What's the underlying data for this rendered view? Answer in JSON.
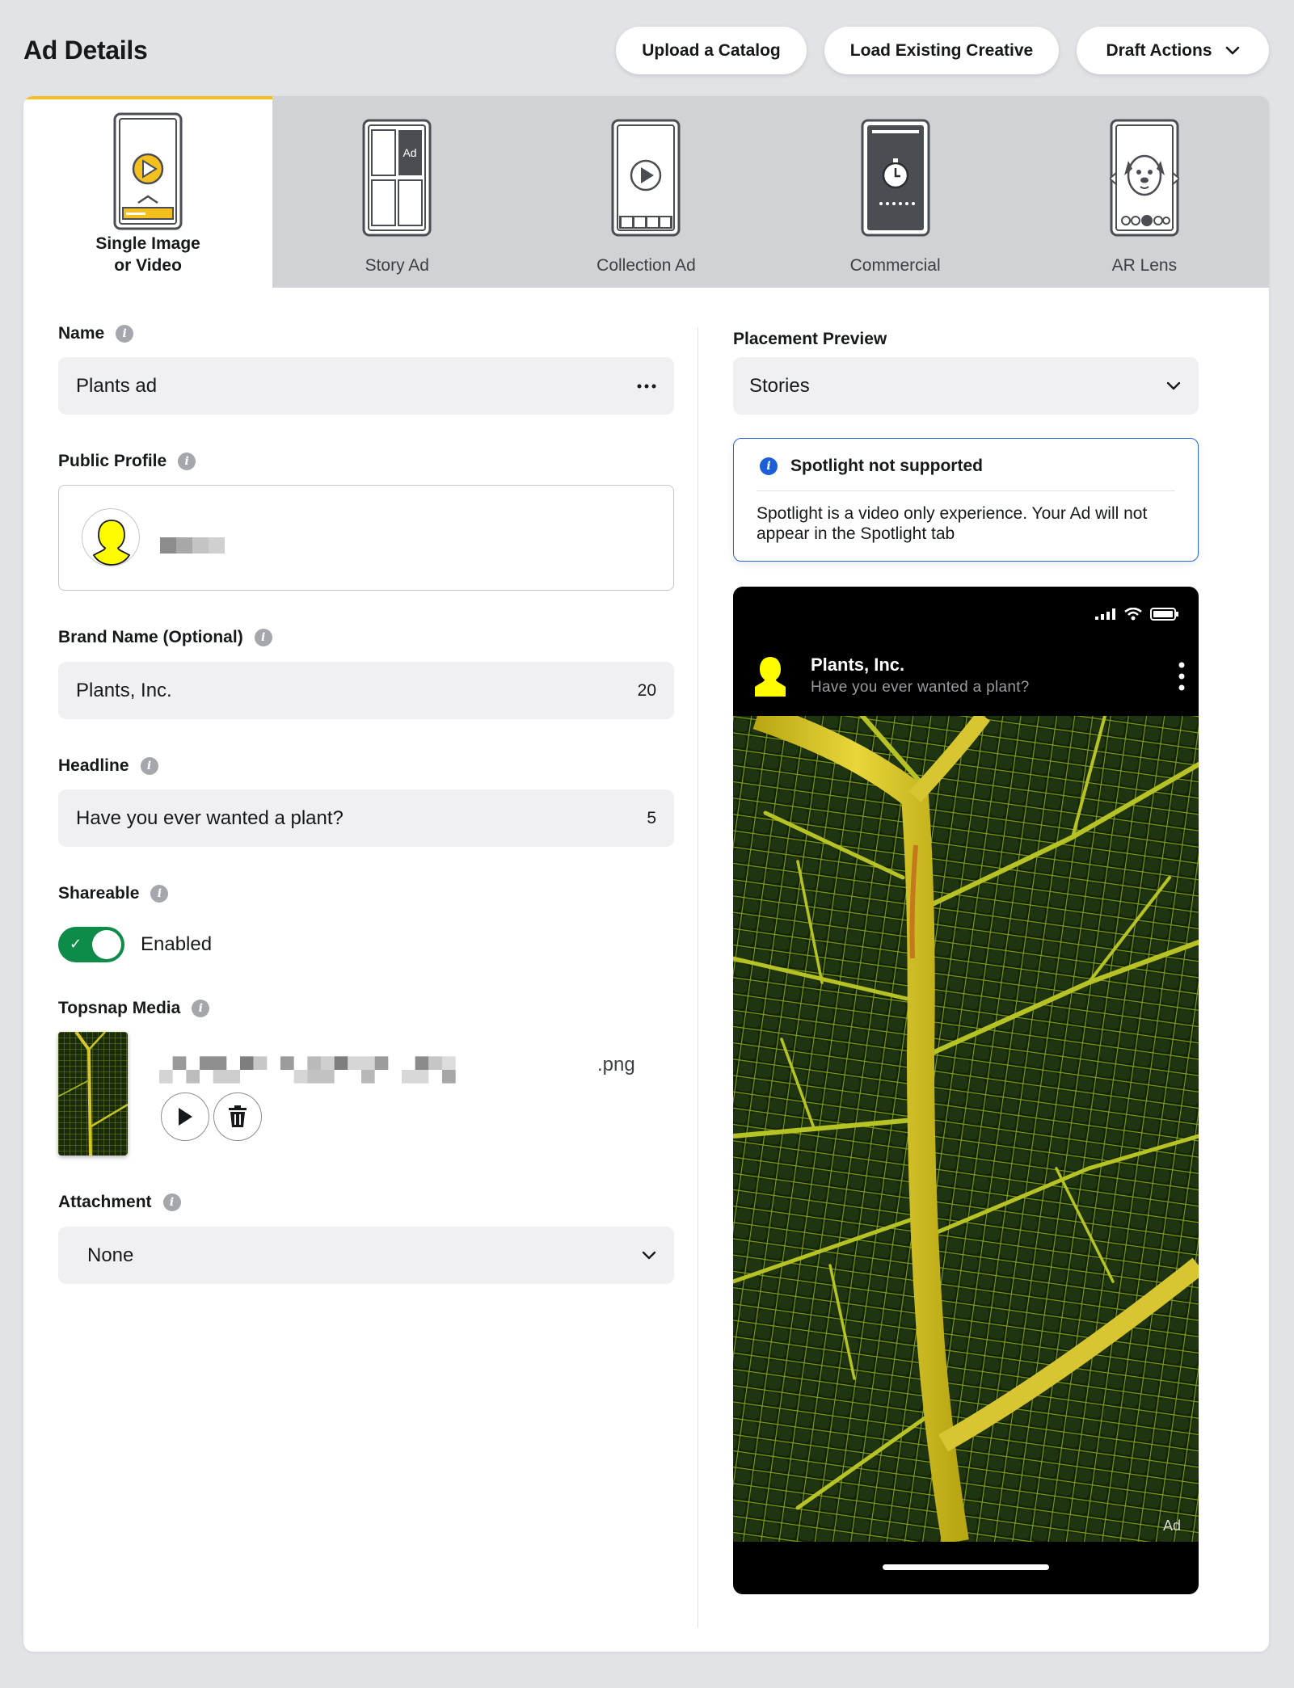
{
  "header": {
    "title": "Ad Details",
    "upload_catalog": "Upload a Catalog",
    "load_creative": "Load Existing Creative",
    "draft_actions": "Draft Actions"
  },
  "tabs": [
    {
      "label": "Single Image or Video",
      "icon": "single-image-video-icon",
      "active": true
    },
    {
      "label": "Story Ad",
      "icon": "story-ad-icon",
      "active": false
    },
    {
      "label": "Collection Ad",
      "icon": "collection-ad-icon",
      "active": false
    },
    {
      "label": "Commercial",
      "icon": "commercial-icon",
      "active": false
    },
    {
      "label": "AR Lens",
      "icon": "ar-lens-icon",
      "active": false
    }
  ],
  "form": {
    "name_label": "Name",
    "name_value": "Plants ad",
    "public_profile_label": "Public Profile",
    "brand_label": "Brand Name (Optional)",
    "brand_value": "Plants, Inc.",
    "brand_count": "20",
    "headline_label": "Headline",
    "headline_value": "Have you ever wanted a plant?",
    "headline_count": "5",
    "shareable_label": "Shareable",
    "shareable_state": "Enabled",
    "topsnap_label": "Topsnap Media",
    "file_ext": ".png",
    "attachment_label": "Attachment",
    "attachment_value": "None"
  },
  "preview": {
    "placement_label": "Placement Preview",
    "placement_value": "Stories",
    "notice_title": "Spotlight not supported",
    "notice_body": "Spotlight is a video only experience. Your Ad will not appear in the Spotlight tab",
    "brand_name": "Plants, Inc.",
    "headline": "Have you ever wanted a plant?",
    "ad_tag": "Ad"
  },
  "colors": {
    "accent_yellow": "#f4c01f",
    "toggle_green": "#0d8b48",
    "info_blue": "#1b5ed8"
  }
}
